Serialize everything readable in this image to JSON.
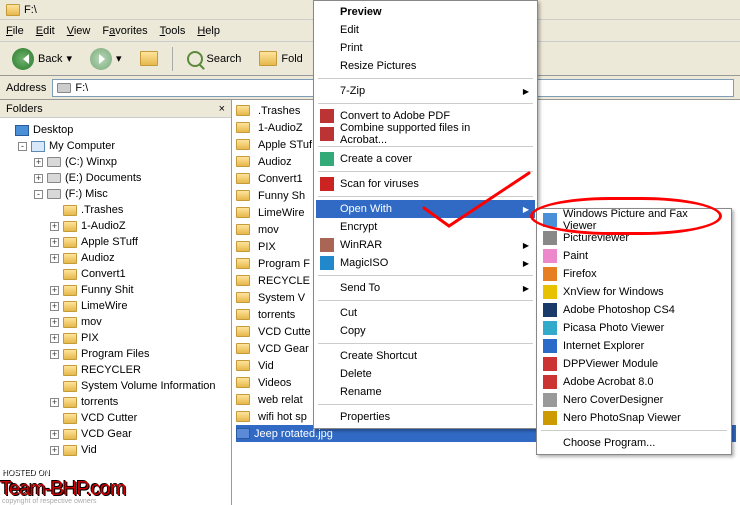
{
  "title": "F:\\",
  "menubar": [
    "File",
    "Edit",
    "View",
    "Favorites",
    "Tools",
    "Help"
  ],
  "toolbar": {
    "back": "Back",
    "search": "Search",
    "folders": "Fold"
  },
  "addressbar": {
    "label": "Address",
    "value": "F:\\"
  },
  "sidepanel": {
    "title": "Folders"
  },
  "tree": [
    {
      "depth": 0,
      "exp": "",
      "ico": "desktop",
      "label": "Desktop"
    },
    {
      "depth": 1,
      "exp": "-",
      "ico": "mycomp",
      "label": "My Computer"
    },
    {
      "depth": 2,
      "exp": "+",
      "ico": "drive",
      "label": "(C:) Winxp"
    },
    {
      "depth": 2,
      "exp": "+",
      "ico": "drive",
      "label": "(E:) Documents"
    },
    {
      "depth": 2,
      "exp": "-",
      "ico": "drive",
      "label": "(F:) Misc"
    },
    {
      "depth": 3,
      "exp": "",
      "ico": "folder",
      "label": ".Trashes"
    },
    {
      "depth": 3,
      "exp": "+",
      "ico": "folder",
      "label": "1-AudioZ"
    },
    {
      "depth": 3,
      "exp": "+",
      "ico": "folder",
      "label": "Apple STuff"
    },
    {
      "depth": 3,
      "exp": "+",
      "ico": "folder",
      "label": "Audioz"
    },
    {
      "depth": 3,
      "exp": "",
      "ico": "folder",
      "label": "Convert1"
    },
    {
      "depth": 3,
      "exp": "+",
      "ico": "folder",
      "label": "Funny Shit"
    },
    {
      "depth": 3,
      "exp": "+",
      "ico": "folder",
      "label": "LimeWire"
    },
    {
      "depth": 3,
      "exp": "+",
      "ico": "folder",
      "label": "mov"
    },
    {
      "depth": 3,
      "exp": "+",
      "ico": "folder",
      "label": "PIX"
    },
    {
      "depth": 3,
      "exp": "+",
      "ico": "folder",
      "label": "Program Files"
    },
    {
      "depth": 3,
      "exp": "",
      "ico": "folder",
      "label": "RECYCLER"
    },
    {
      "depth": 3,
      "exp": "",
      "ico": "folder",
      "label": "System Volume Information"
    },
    {
      "depth": 3,
      "exp": "+",
      "ico": "folder",
      "label": "torrents"
    },
    {
      "depth": 3,
      "exp": "",
      "ico": "folder",
      "label": "VCD Cutter"
    },
    {
      "depth": 3,
      "exp": "+",
      "ico": "folder",
      "label": "VCD Gear"
    },
    {
      "depth": 3,
      "exp": "+",
      "ico": "folder",
      "label": "Vid"
    }
  ],
  "files": [
    {
      "ico": "folder",
      "label": ".Trashes"
    },
    {
      "ico": "folder",
      "label": "1-AudioZ"
    },
    {
      "ico": "folder",
      "label": "Apple STuf"
    },
    {
      "ico": "folder",
      "label": "Audioz"
    },
    {
      "ico": "folder",
      "label": "Convert1"
    },
    {
      "ico": "folder",
      "label": "Funny Sh"
    },
    {
      "ico": "folder",
      "label": "LimeWire"
    },
    {
      "ico": "folder",
      "label": "mov"
    },
    {
      "ico": "folder",
      "label": "PIX"
    },
    {
      "ico": "folder",
      "label": "Program F"
    },
    {
      "ico": "folder",
      "label": "RECYCLE"
    },
    {
      "ico": "folder",
      "label": "System V"
    },
    {
      "ico": "folder",
      "label": "torrents"
    },
    {
      "ico": "folder",
      "label": "VCD Cutte"
    },
    {
      "ico": "folder",
      "label": "VCD Gear"
    },
    {
      "ico": "folder",
      "label": "Vid"
    },
    {
      "ico": "folder",
      "label": "Videos"
    },
    {
      "ico": "folder",
      "label": "web relat"
    },
    {
      "ico": "folder",
      "label": "wifi hot sp"
    },
    {
      "ico": "img",
      "label": "Jeep rotated.jpg",
      "sel": true
    }
  ],
  "ctx": {
    "items": [
      {
        "t": "Preview",
        "b": true
      },
      {
        "t": "Edit"
      },
      {
        "t": "Print"
      },
      {
        "t": "Resize Pictures"
      },
      {
        "sep": true
      },
      {
        "t": "7-Zip",
        "arrow": true
      },
      {
        "sep": true
      },
      {
        "t": "Convert to Adobe PDF",
        "ico": "#b33"
      },
      {
        "t": "Combine supported files in Acrobat...",
        "ico": "#b33"
      },
      {
        "sep": true
      },
      {
        "t": "Create a cover",
        "ico": "#3a7"
      },
      {
        "sep": true
      },
      {
        "t": "Scan for viruses",
        "ico": "#c22"
      },
      {
        "sep": true
      },
      {
        "t": "Open With",
        "arrow": true,
        "hl": true
      },
      {
        "t": "Encrypt"
      },
      {
        "t": "WinRAR",
        "arrow": true,
        "ico": "#a65"
      },
      {
        "t": "MagicISO",
        "arrow": true,
        "ico": "#28c"
      },
      {
        "sep": true
      },
      {
        "t": "Send To",
        "arrow": true
      },
      {
        "sep": true
      },
      {
        "t": "Cut"
      },
      {
        "t": "Copy"
      },
      {
        "sep": true
      },
      {
        "t": "Create Shortcut"
      },
      {
        "t": "Delete"
      },
      {
        "t": "Rename"
      },
      {
        "sep": true
      },
      {
        "t": "Properties"
      }
    ]
  },
  "submenu": {
    "items": [
      {
        "t": "Windows Picture and Fax Viewer",
        "ico": "#4a90d8"
      },
      {
        "t": "Pictureviewer",
        "ico": "#888"
      },
      {
        "t": "Paint",
        "ico": "#e8c"
      },
      {
        "t": "Firefox",
        "ico": "#e67e22"
      },
      {
        "t": "XnView for Windows",
        "ico": "#e6c200"
      },
      {
        "t": "Adobe Photoshop CS4",
        "ico": "#1a3a6a"
      },
      {
        "t": "Picasa Photo Viewer",
        "ico": "#3ac"
      },
      {
        "t": "Internet Explorer",
        "ico": "#2a6ac8"
      },
      {
        "t": "DPPViewer Module",
        "ico": "#c33"
      },
      {
        "t": "Adobe Acrobat 8.0",
        "ico": "#c33"
      },
      {
        "t": "Nero CoverDesigner",
        "ico": "#999"
      },
      {
        "t": "Nero PhotoSnap Viewer",
        "ico": "#c90"
      },
      {
        "sep": true
      },
      {
        "t": "Choose Program..."
      }
    ]
  },
  "watermark": {
    "hosted": "HOSTED ON",
    "brand": "Team-BHP.com",
    "copy": "copyright of respective owners"
  }
}
